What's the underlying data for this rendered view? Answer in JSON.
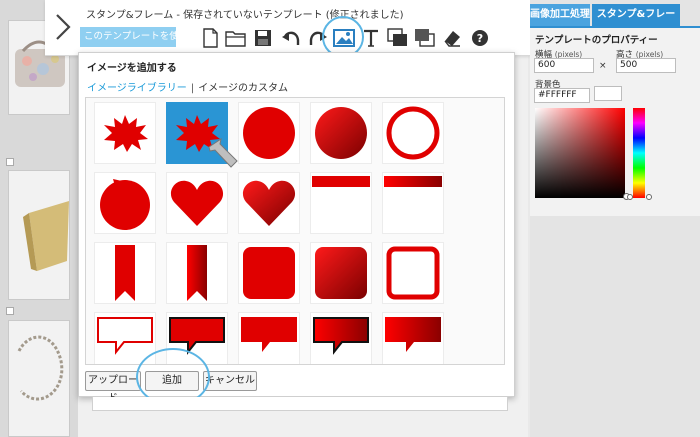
{
  "header": {
    "title": "スタンプ&フレーム - 保存されていないテンプレート (修正されました)",
    "use_template_label": "このテンプレートを使用"
  },
  "toolbar": {
    "tools": [
      "new-file-icon",
      "open-folder-icon",
      "save-icon",
      "undo-icon",
      "redo-icon",
      "add-image-icon",
      "text-icon",
      "bring-forward-icon",
      "send-backward-icon",
      "eraser-icon",
      "help-icon"
    ],
    "active_tool": "add-image-icon"
  },
  "dialog": {
    "title": "イメージを追加する",
    "tabs": {
      "library": "イメージライブラリー",
      "separator": "|",
      "custom": "イメージのカスタム"
    },
    "selected_index": 1,
    "buttons": {
      "upload": "アップロード",
      "add": "追加",
      "cancel": "キャンセル"
    },
    "shapes": [
      "starburst",
      "starburst",
      "circle",
      "circle-gradient",
      "ring",
      "seal",
      "heart",
      "heart-gradient",
      "top-bar",
      "top-bar-gradient",
      "ribbon",
      "ribbon-gradient",
      "rounded-square",
      "rounded-square-gradient",
      "square-frame",
      "speech-outline",
      "speech-black-border",
      "speech",
      "speech-gradient-border",
      "speech-gradient"
    ]
  },
  "right_panel": {
    "tabs": {
      "image_processing": "画像加工処理",
      "stamp_frame": "スタンプ&フレーム"
    },
    "properties_title": "テンプレートのプロパティー",
    "width_label": "横幅",
    "width_unit": "(pixels)",
    "width_value": "600",
    "height_label": "高さ",
    "height_unit": "(pixels)",
    "height_value": "500",
    "times": "×",
    "bg_label": "背景色",
    "bg_value": "#FFFFFF"
  },
  "colors": {
    "accent": "#2a95d4",
    "shape_red": "#e00000",
    "annotation": "#5bb5e4"
  }
}
